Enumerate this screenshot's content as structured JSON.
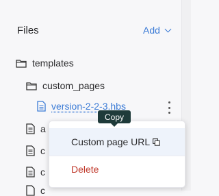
{
  "header": {
    "title": "Files",
    "add_label": "Add"
  },
  "tree": {
    "templates": {
      "label": "templates",
      "icon": "folder-icon"
    },
    "custom_pages": {
      "label": "custom_pages",
      "icon": "folder-icon"
    },
    "version_file": {
      "label": "version-2-2-3.hbs",
      "icon": "file-icon"
    },
    "file_a": {
      "label": "a",
      "icon": "file-icon"
    },
    "file_c1": {
      "label": "c",
      "icon": "file-icon"
    },
    "file_c2": {
      "label": "c",
      "icon": "file-icon"
    },
    "file_c3": {
      "label": "c",
      "icon": "file-icon"
    }
  },
  "context_menu": {
    "items": [
      {
        "label": "Custom page URL",
        "icon": "copy-icon"
      },
      {
        "label": "Delete"
      }
    ]
  },
  "tooltip": {
    "text": "Copy"
  },
  "colors": {
    "accent": "#3b7bd6",
    "danger": "#c0392b",
    "tooltip_bg": "#1f3b3a"
  }
}
